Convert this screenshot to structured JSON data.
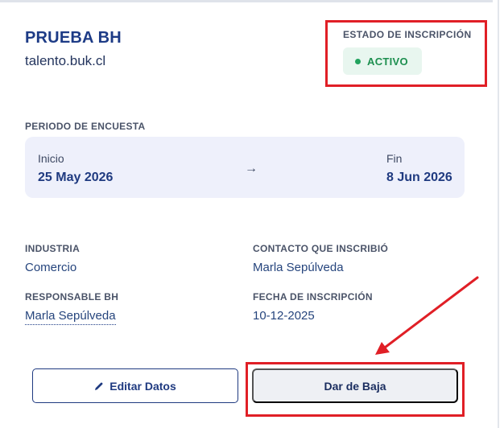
{
  "company": {
    "name": "PRUEBA BH",
    "domain": "talento.buk.cl"
  },
  "status": {
    "label": "ESTADO DE INSCRIPCIÓN",
    "value": "ACTIVO",
    "color": "#22a35e"
  },
  "survey_period": {
    "label": "PERIODO DE ENCUESTA",
    "start_label": "Inicio",
    "start_date": "25 May 2026",
    "arrow": "→",
    "end_label": "Fin",
    "end_date": "8 Jun 2026"
  },
  "details": {
    "industry_label": "INDUSTRIA",
    "industry_value": "Comercio",
    "contact_label": "CONTACTO QUE INSCRIBIÓ",
    "contact_value": "Marla Sepúlveda",
    "responsible_label": "RESPONSABLE BH",
    "responsible_value": "Marla Sepúlveda",
    "registration_date_label": "FECHA DE INSCRIPCIÓN",
    "registration_date_value": "10-12-2025"
  },
  "actions": {
    "edit_label": "Editar Datos",
    "deregister_label": "Dar de Baja"
  },
  "colors": {
    "brand": "#1f3a80",
    "annotation": "#e01f26",
    "status_bg": "#e8f6ef",
    "period_bg": "#eef0fb"
  }
}
